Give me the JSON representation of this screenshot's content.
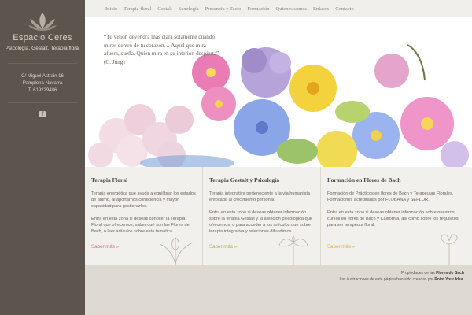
{
  "sidebar": {
    "logo_name": "Espacio Ceres",
    "tagline": "Psicología. Gestalt. Terapia floral",
    "address": [
      "C/ Miguel Astrain 16",
      "Pamplona-Navarra",
      "T. 619229486"
    ],
    "social_icon": "facebook-icon"
  },
  "nav": {
    "items": [
      "Inicio",
      "Terapia floral",
      "Gestalt",
      "Sexología",
      "Presencia y Tacto",
      "Formación",
      "Quienes somos",
      "Enlaces",
      "Contacto"
    ]
  },
  "hero": {
    "quote": "“Tu visión devendrá más clara solamente cuando mires dentro de tu corazón… Aquel que mira afuera, sueña. Quien mira en su interior, despierta” (C. Jung)"
  },
  "columns": [
    {
      "title": "Terapia Floral",
      "p1": "Terapia energética que ayuda a equilibrar los estados de ánimo, al aportarnos consciencia y mayor capacidad para gestionarlos.",
      "p2": "Entra en esta zona si deseas conocer la Terapia Floral que ofrecemos, saber qué son las Flores de Bach, o leer artículos sobre esta temática.",
      "more": "Saber más »",
      "accent": "#d46a7e"
    },
    {
      "title": "Terapia Gestalt y Psicología",
      "p1": "Terapia integrativa perteneciente a la vía humanista enfocada al crecimiento personal.",
      "p2": "Entra en esta zona si deseas obtener información sobre la terapia Gestalt y la atención psicológica que ofrecemos, o para acceder a los artículos que sobre terapia integrativa y relaciones difundimos.",
      "more": "Saber más »",
      "accent": "#9fb22f"
    },
    {
      "title": "Formación en Flores de Bach",
      "p1": "Formación de Prácticos en flores de Bach y Terapeutas Florales. Formaciones acreditadas por FLOBANA y SEFLOR.",
      "p2": "Entra en esta zona si deseas obtener información sobre nuestros cursos en flores de Bach y California, así como sobre los requisitos para ser terapeuta floral.",
      "more": "Saber más »",
      "accent": "#e2a72a"
    }
  ],
  "footer": {
    "line1_prefix": "Propiedades de las",
    "line1_link": "Flores de Bach",
    "line2_prefix": "Las ilustraciones de esta página han sido creadas por",
    "line2_link": "Point Your Idea."
  }
}
